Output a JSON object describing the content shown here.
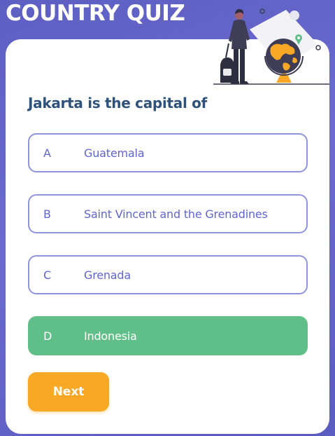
{
  "app": {
    "title": "COUNTRY QUIZ"
  },
  "quiz": {
    "question": "Jakarta is the capital of",
    "options": [
      {
        "letter": "A",
        "text": "Guatemala",
        "state": "default"
      },
      {
        "letter": "B",
        "text": "Saint Vincent and the Grenadines",
        "state": "default"
      },
      {
        "letter": "C",
        "text": "Grenada",
        "state": "default"
      },
      {
        "letter": "D",
        "text": "Indonesia",
        "state": "correct"
      }
    ],
    "next_label": "Next"
  },
  "illustration": {
    "icon": "traveler-globe-icon"
  },
  "colors": {
    "background": "#5e5fc2",
    "card": "#ffffff",
    "question_text": "#2f527b",
    "option_border": "#6066d0",
    "correct": "#60bf88",
    "next_button": "#f9a826",
    "globe": "#f9a826"
  }
}
